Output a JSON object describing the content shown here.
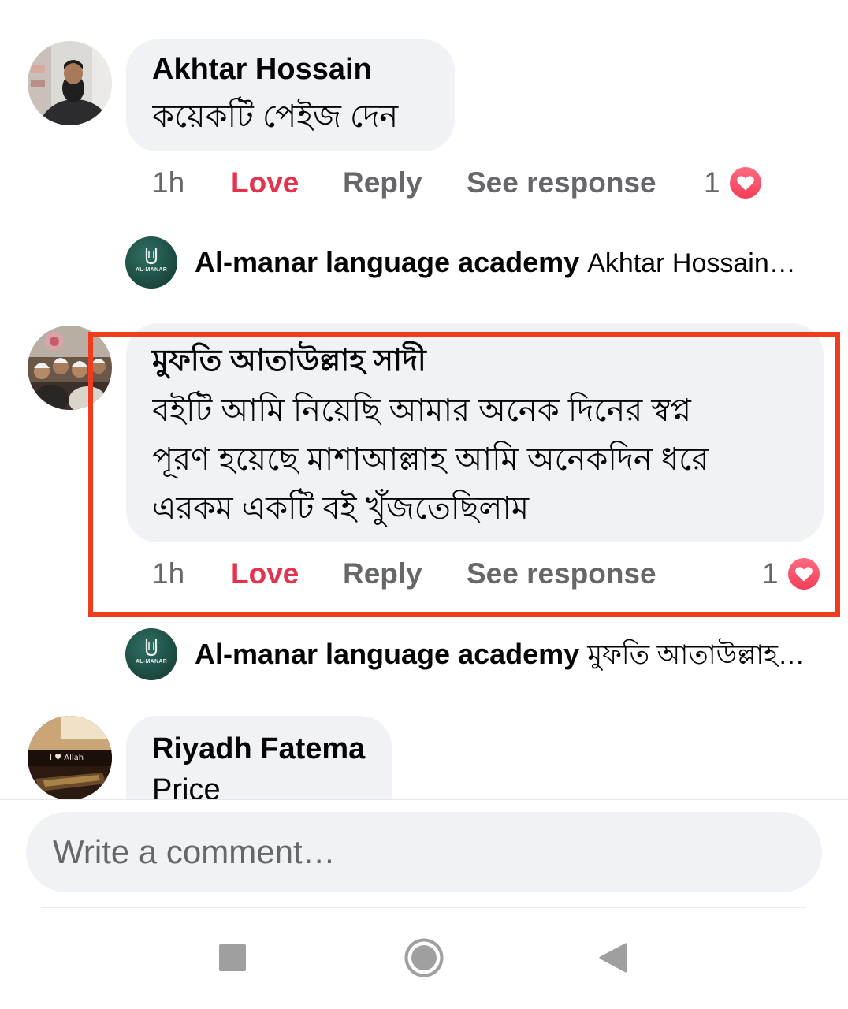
{
  "comments": [
    {
      "author": "Akhtar Hossain",
      "text_lines": [
        "কয়েকটি পেইজ দেন"
      ],
      "time": "1h",
      "love_label": "Love",
      "reply_label": "Reply",
      "see_response_label": "See response",
      "reaction_count": "1",
      "reaction_icon": "love-reaction-icon",
      "reply_preview": {
        "author": "Al-manar language academy",
        "snippet": "Akhtar Hossain…",
        "logo_text": "AL-MANAR"
      }
    },
    {
      "author": "মুফতি আতাউল্লাহ সাদী",
      "text_lines": [
        "বইটি আমি নিয়েছি আমার অনেক দিনের স্বপ্ন",
        "পূরণ হয়েছে মাশাআল্লাহ আমি অনেকদিন ধরে",
        "এরকম একটি বই খুঁজতেছিলাম"
      ],
      "time": "1h",
      "love_label": "Love",
      "reply_label": "Reply",
      "see_response_label": "See response",
      "reaction_count": "1",
      "reaction_icon": "love-reaction-icon",
      "reply_preview": {
        "author": "Al-manar language academy",
        "snippet": "মুফতি আতাউল্লাহ…",
        "logo_text": "AL-MANAR"
      }
    },
    {
      "author": "Riyadh Fatema",
      "text_lines": [
        "Price"
      ],
      "avatar_caption": "I ♥ Allah"
    }
  ],
  "composer": {
    "placeholder": "Write a comment…"
  },
  "navigation": {
    "recents_icon": "square-icon",
    "home_icon": "circle-icon",
    "back_icon": "back-triangle-icon"
  },
  "colors": {
    "bubble": "#f0f2f5",
    "author_text": "#050505",
    "muted_text": "#65676b",
    "love_text": "#e4334f",
    "love_reaction": "#f33e58",
    "highlight_border": "#f03c1e",
    "brand_green": "#1d4d44",
    "nav_icon": "#9f9f9f"
  }
}
